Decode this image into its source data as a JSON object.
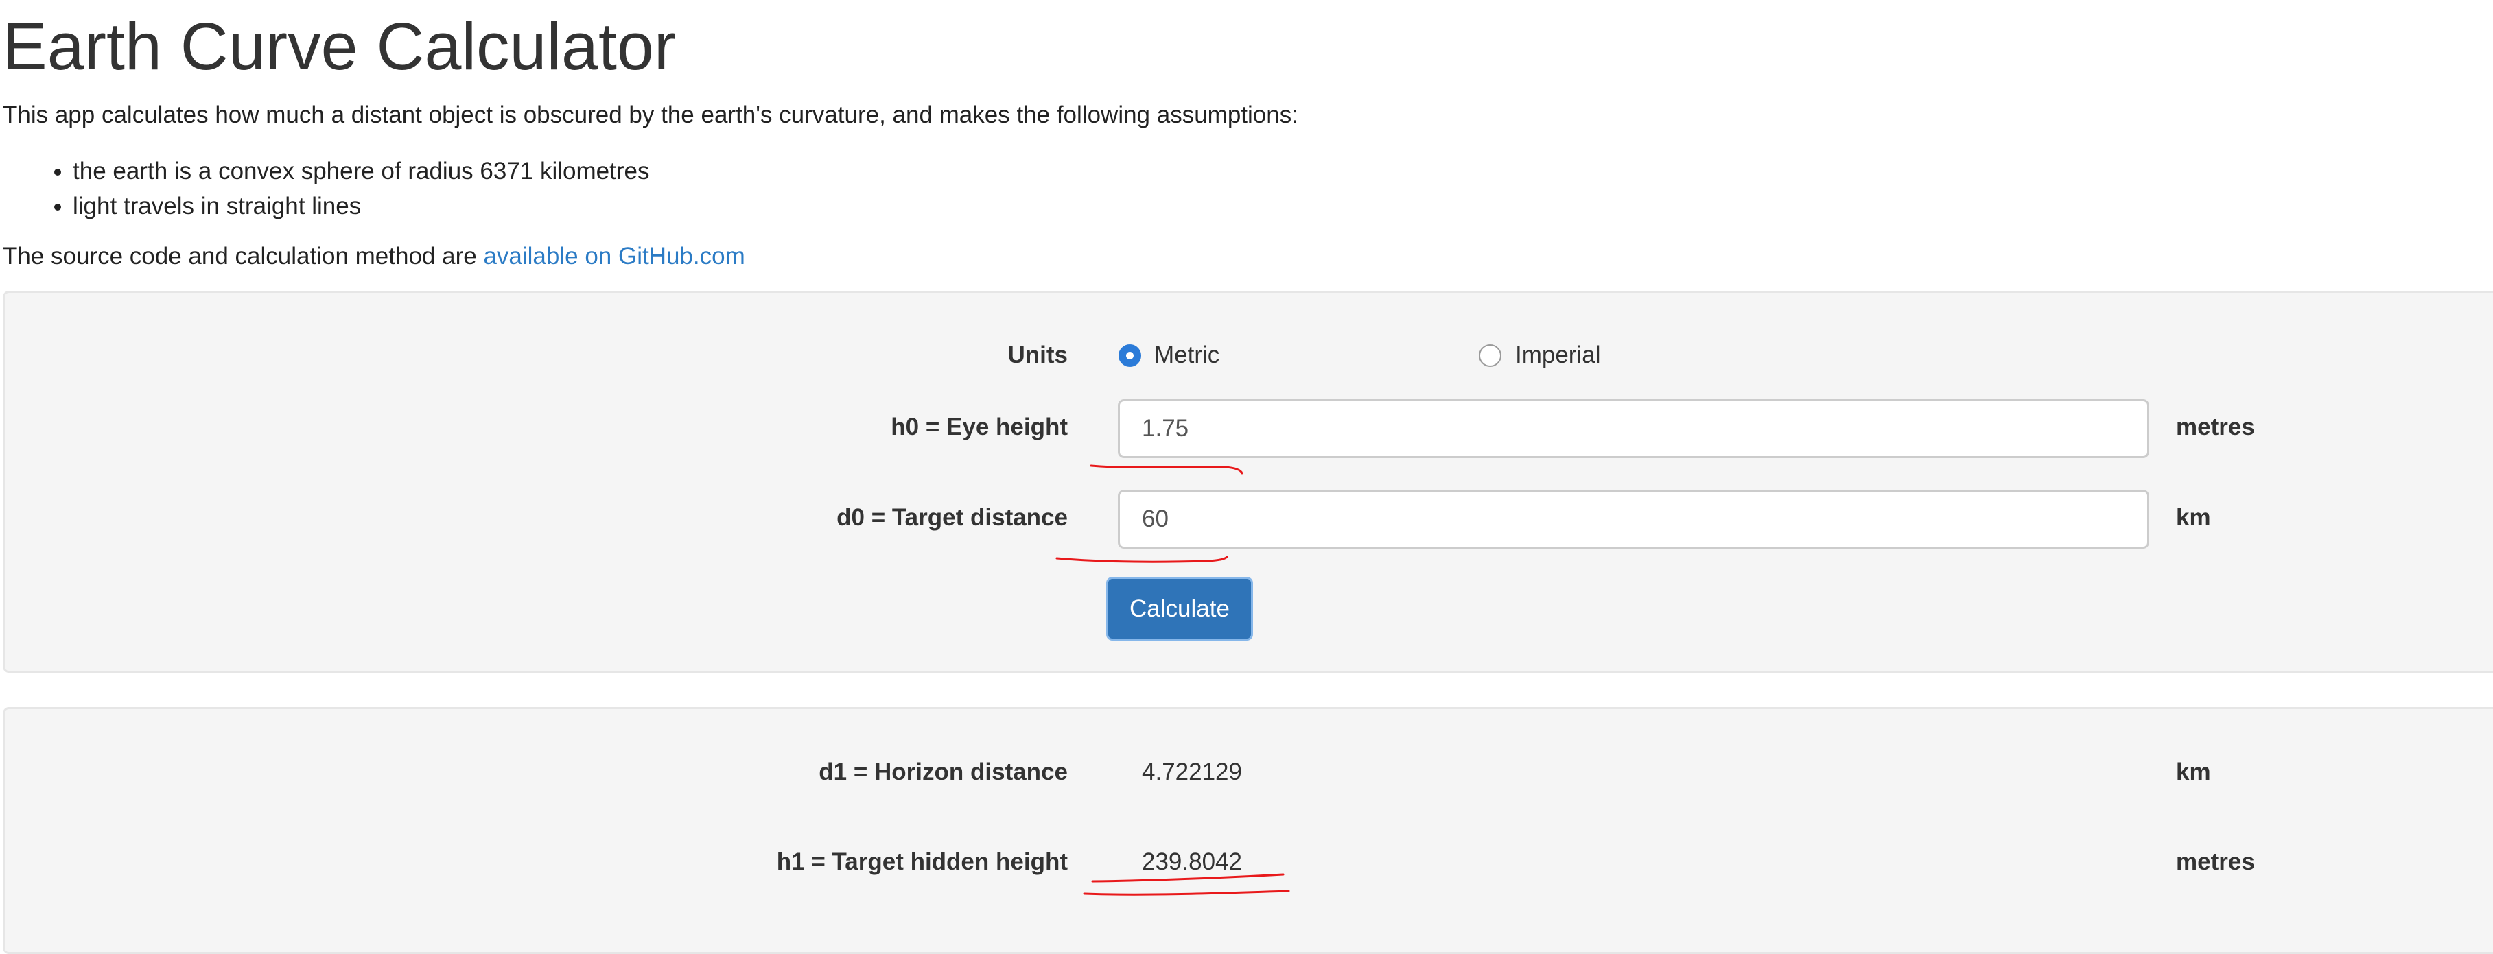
{
  "title": "Earth Curve Calculator",
  "intro": "This app calculates how much a distant object is obscured by the earth's curvature, and makes the following assumptions:",
  "assumptions": [
    "the earth is a convex sphere of radius 6371 kilometres",
    "light travels in straight lines"
  ],
  "source": {
    "text": "The source code and calculation method are ",
    "link_text": "available on GitHub.com"
  },
  "form": {
    "units_label": "Units",
    "units_options": [
      {
        "label": "Metric",
        "checked": true
      },
      {
        "label": "Imperial",
        "checked": false
      }
    ],
    "eye_height": {
      "label": "h0 = Eye height",
      "value": "1.75",
      "unit": "metres"
    },
    "target_distance": {
      "label": "d0 = Target distance",
      "value": "60",
      "unit": "km"
    },
    "calculate_label": "Calculate"
  },
  "results": {
    "horizon_distance": {
      "label": "d1 = Horizon distance",
      "value": "4.722129",
      "unit": "km"
    },
    "hidden_height": {
      "label": "h1 = Target hidden height",
      "value": "239.8042",
      "unit": "metres"
    }
  },
  "colors": {
    "accent": "#2b7bd8",
    "link": "#2b7bc5",
    "button": "#2f74b8",
    "annotation": "#e8191b"
  }
}
